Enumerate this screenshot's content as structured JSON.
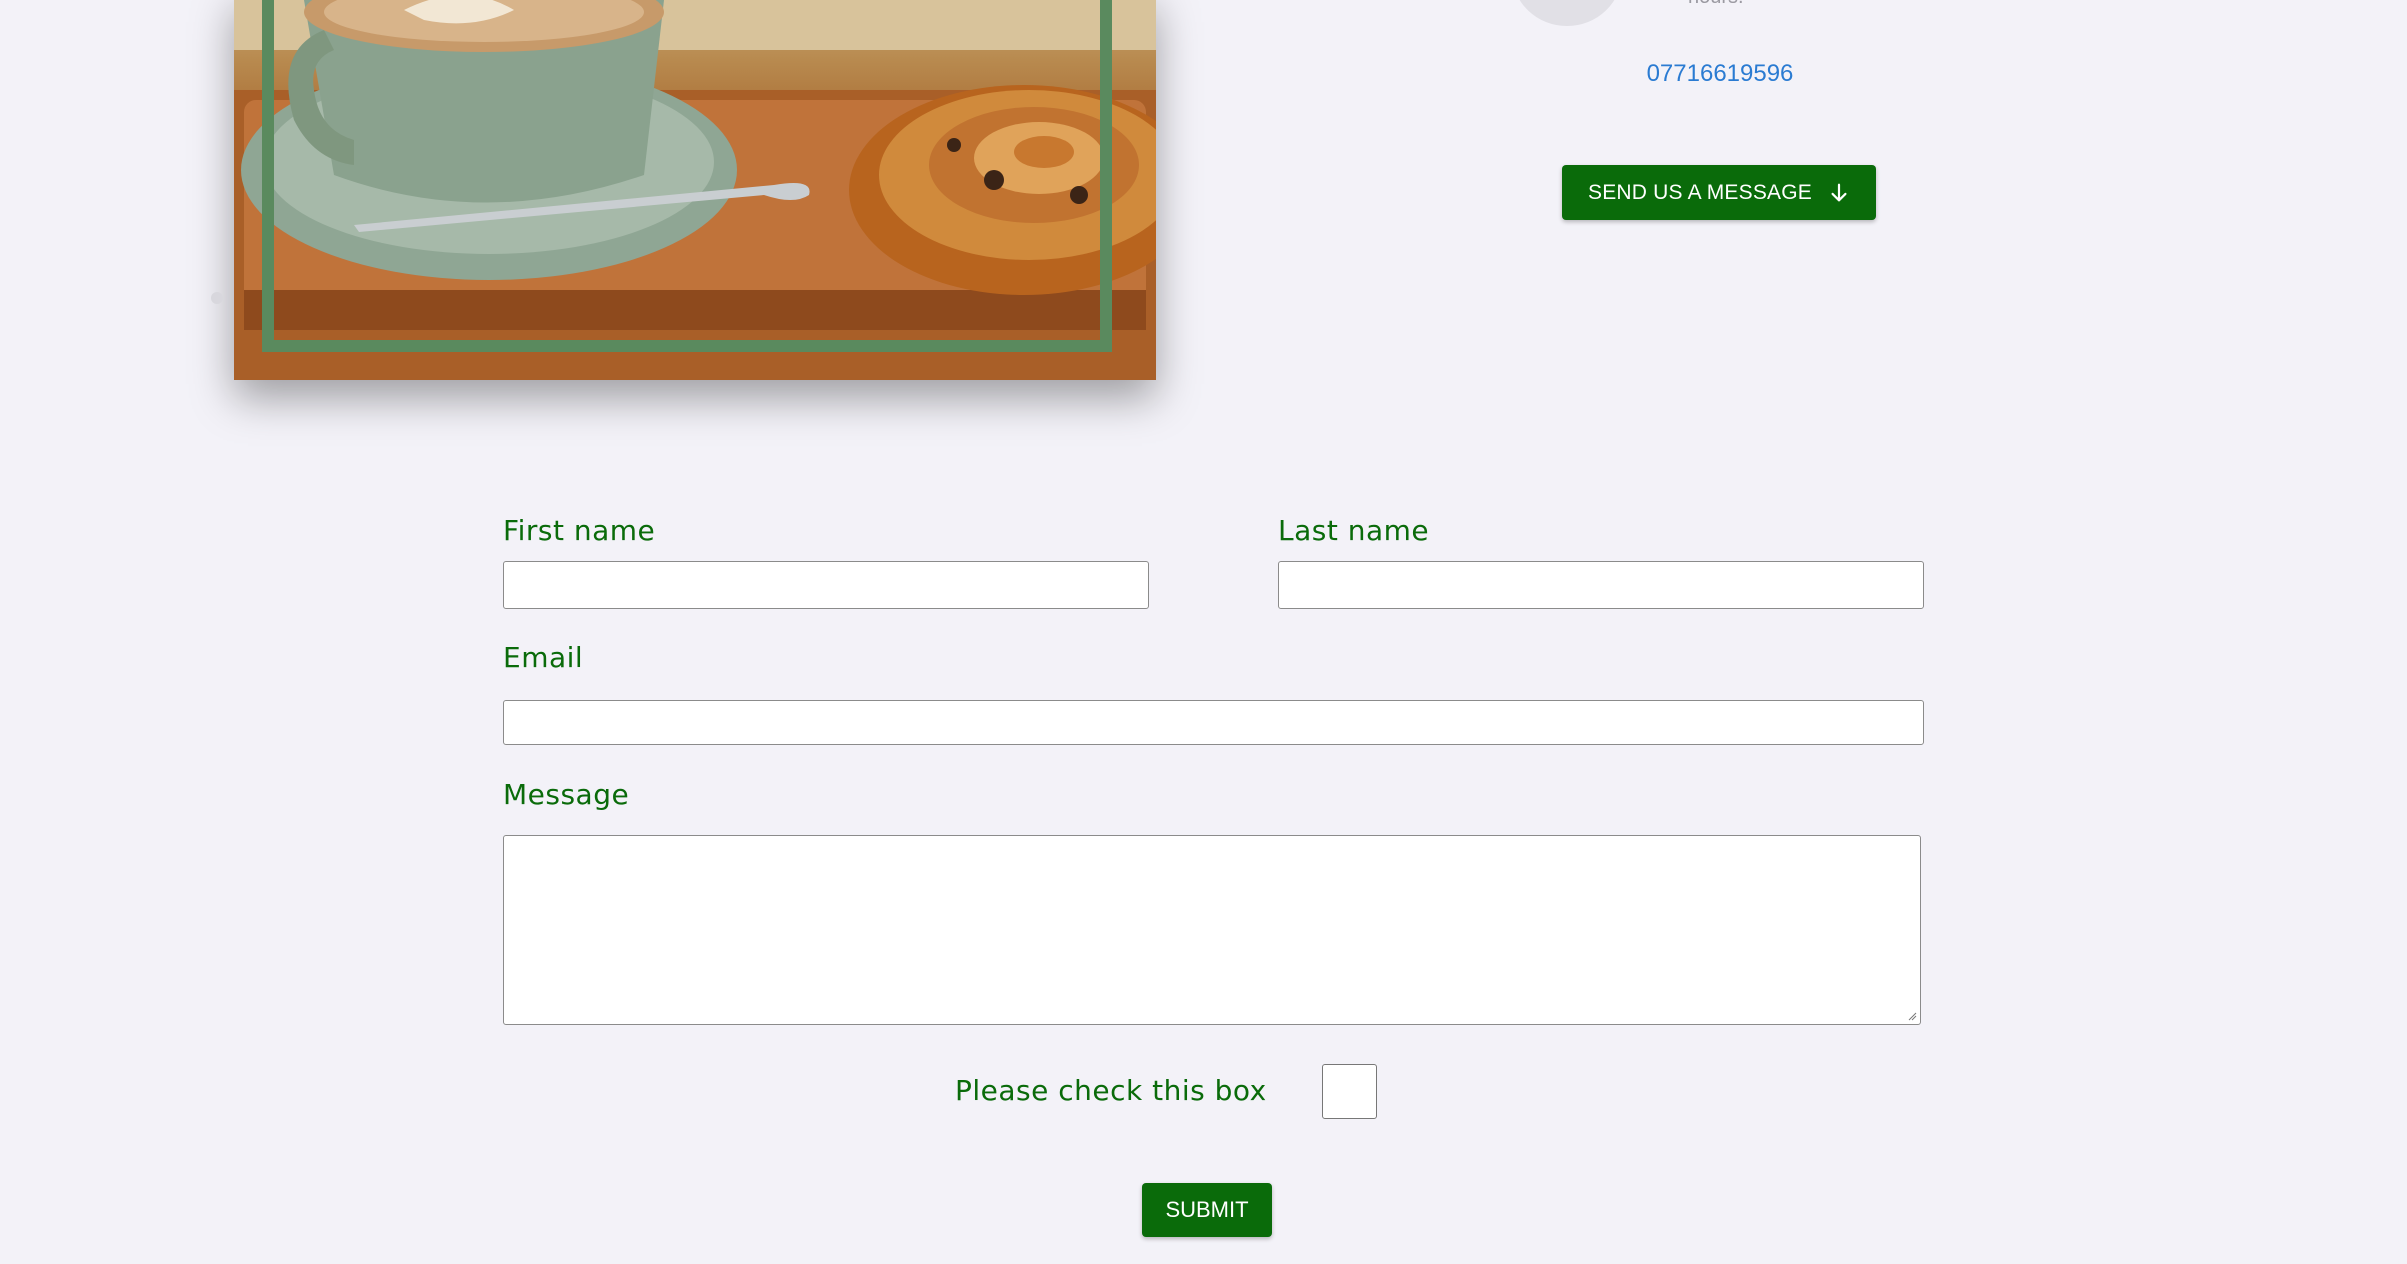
{
  "contact": {
    "hours_text": "hours.",
    "phone": "07716619596",
    "send_button_label": "SEND US A MESSAGE"
  },
  "form": {
    "first_name_label": "First name",
    "last_name_label": "Last name",
    "email_label": "Email",
    "message_label": "Message",
    "checkbox_label": "Please check this box",
    "submit_label": "SUBMIT",
    "first_name_value": "",
    "last_name_value": "",
    "email_value": "",
    "message_value": ""
  },
  "colors": {
    "brand_green": "#0a6b0a",
    "link_blue": "#2a7bd2",
    "frame_green": "#5a8a5e",
    "page_background": "#f3f2f8"
  },
  "icons": {
    "send_button_icon": "arrow-down-icon",
    "decorative_dot": "dot-icon"
  }
}
